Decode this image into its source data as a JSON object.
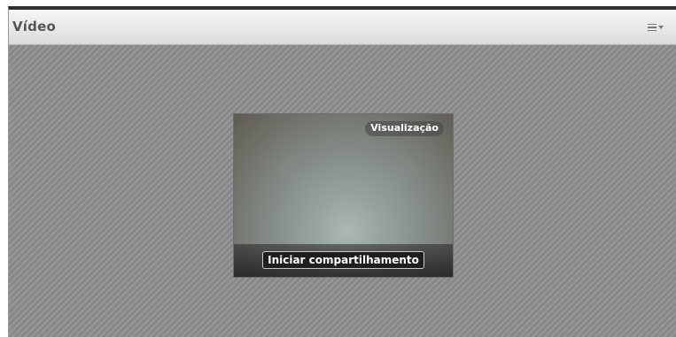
{
  "pod": {
    "title": "Vídeo",
    "menu_icon": "pod-options-menu-icon"
  },
  "video": {
    "preview_label": "Visualização",
    "start_sharing_label": "Iniciar compartilhamento"
  },
  "colors": {
    "frame_border": "#2e2e2e",
    "body_background": "#8f8f8f",
    "button_background": "#1e1e1e"
  }
}
